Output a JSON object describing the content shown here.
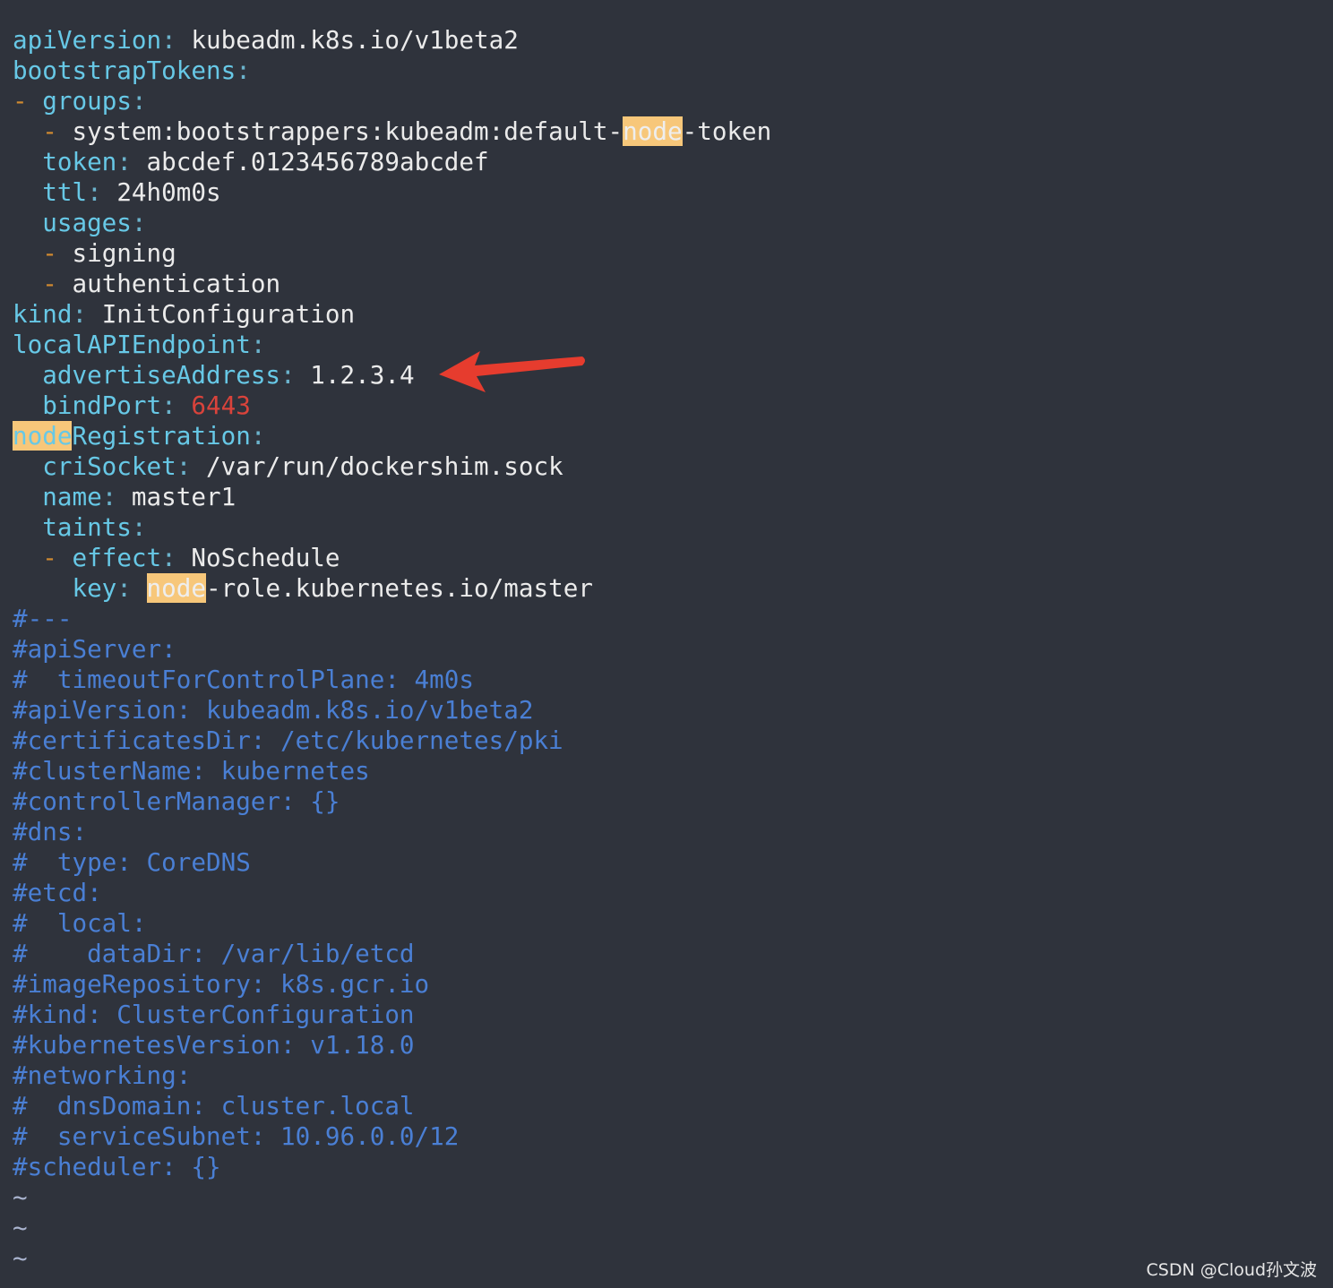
{
  "lines": {
    "l1": {
      "k": "apiVersion",
      "v": " kubeadm.k8s.io/v1beta2"
    },
    "l2": {
      "k": "bootstrapTokens"
    },
    "l3": {
      "d": "-",
      "k": "groups"
    },
    "l4": {
      "d": "-",
      "v1": " system:bootstrappers:kubeadm:default-",
      "hl": "node",
      "v2": "-token"
    },
    "l5": {
      "k": "token",
      "v": " abcdef.0123456789abcdef"
    },
    "l6": {
      "k": "ttl",
      "v": " 24h0m0s"
    },
    "l7": {
      "k": "usages"
    },
    "l8": {
      "d": "-",
      "v": " signing"
    },
    "l9": {
      "d": "-",
      "v": " authentication"
    },
    "l10": {
      "k": "kind",
      "v": " InitConfiguration"
    },
    "l11": {
      "k": "localAPIEndpoint"
    },
    "l12": {
      "k": "advertiseAddress",
      "v": " 1.2.3.4"
    },
    "l13": {
      "k": "bindPort",
      "v": "6443"
    },
    "l14": {
      "hl": "node",
      "k": "Registration"
    },
    "l15": {
      "k": "criSocket",
      "v": " /var/run/dockershim.sock"
    },
    "l16": {
      "k": "name",
      "v": " master1"
    },
    "l17": {
      "k": "taints"
    },
    "l18": {
      "d": "-",
      "k": "effect",
      "v": " NoSchedule"
    },
    "l19": {
      "k": "key",
      "hl": "node",
      "v": "-role.kubernetes.io/master"
    }
  },
  "comments": [
    "#---",
    "#apiServer:",
    "#  timeoutForControlPlane: 4m0s",
    "#apiVersion: kubeadm.k8s.io/v1beta2",
    "#certificatesDir: /etc/kubernetes/pki",
    "#clusterName: kubernetes",
    "#controllerManager: {}",
    "#dns:",
    "#  type: CoreDNS",
    "#etcd:",
    "#  local:",
    "#    dataDir: /var/lib/etcd",
    "#imageRepository: k8s.gcr.io",
    "#kind: ClusterConfiguration",
    "#kubernetesVersion: v1.18.0",
    "#networking:",
    "#  dnsDomain: cluster.local",
    "#  serviceSubnet: 10.96.0.0/12",
    "#scheduler: {}"
  ],
  "tilde": "~",
  "colon": ":",
  "watermark": "CSDN @Cloud孙文波",
  "colors": {
    "background": "#2f333c",
    "key": "#67c8e6",
    "comment": "#4a7fd4",
    "dash": "#d08a30",
    "number": "#d9433b",
    "search_highlight": "#f7c77a",
    "arrow": "#e63c2e"
  }
}
